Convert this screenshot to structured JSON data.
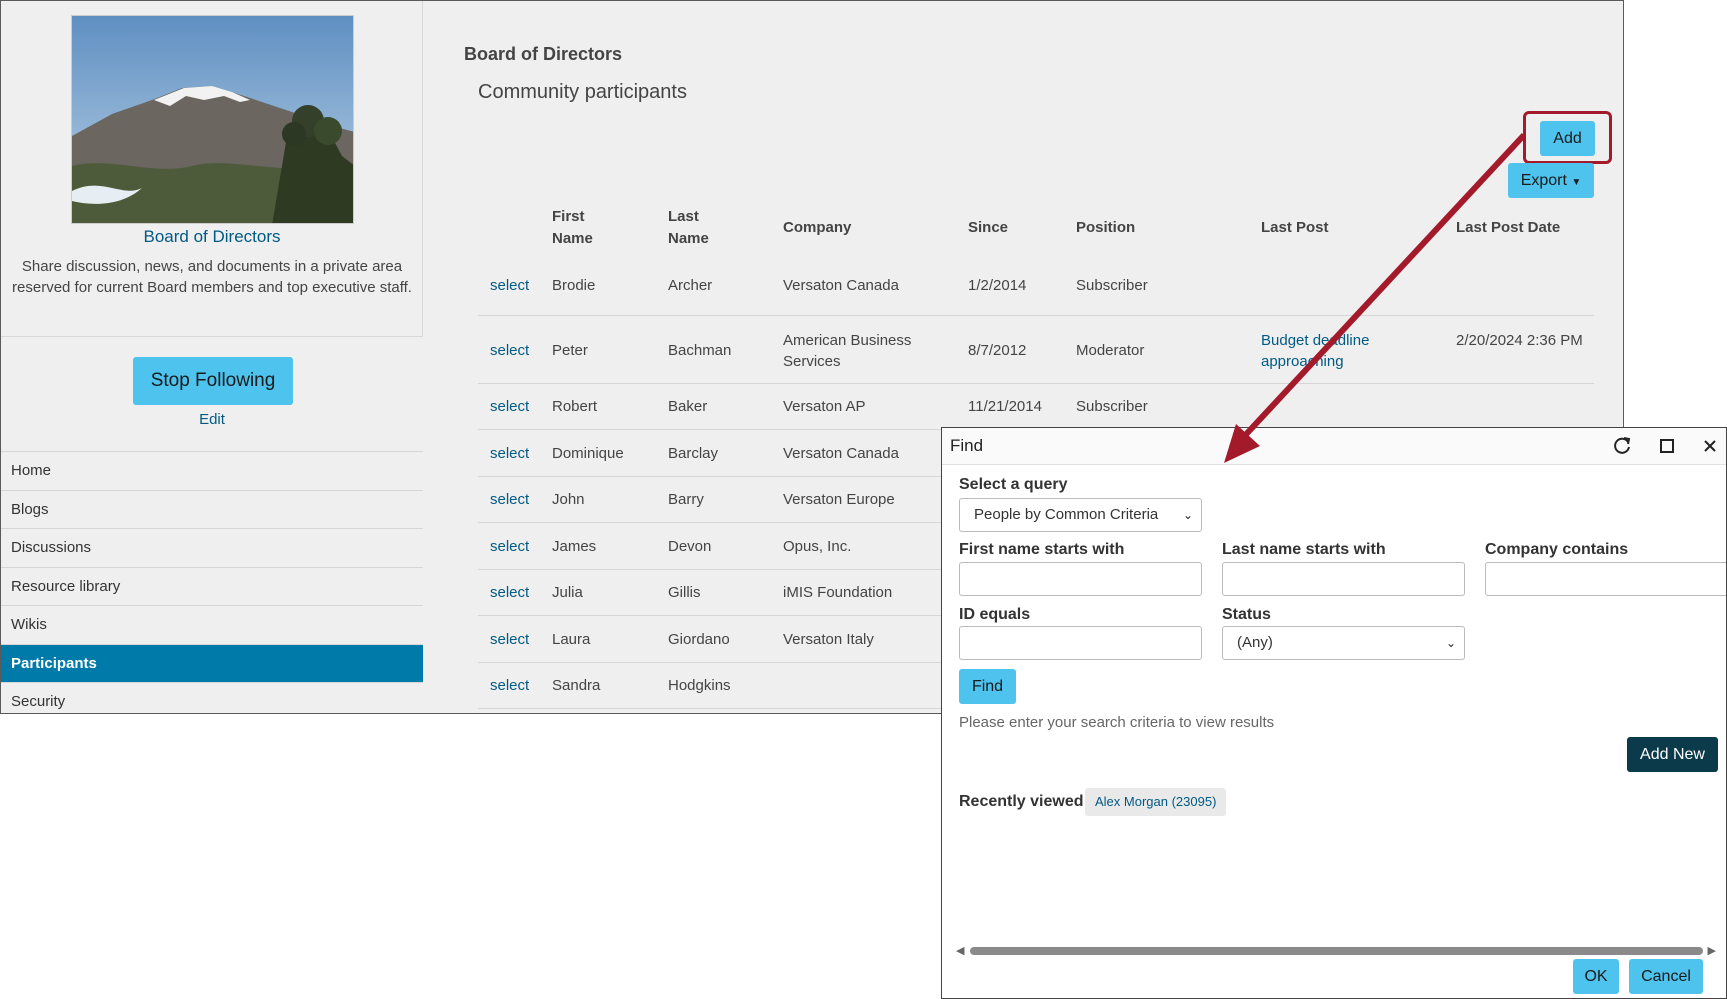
{
  "sidebar": {
    "group_title": "Board of Directors",
    "group_description": "Share discussion, news, and documents in a private area reserved for current Board members and top executive staff.",
    "stop_following_label": "Stop Following",
    "edit_label": "Edit",
    "nav": [
      "Home",
      "Blogs",
      "Discussions",
      "Resource library",
      "Wikis",
      "Participants",
      "Security"
    ],
    "active_nav": "Participants"
  },
  "main": {
    "heading": "Board of Directors",
    "subheading": "Community participants",
    "add_label": "Add",
    "export_label": "Export",
    "columns": {
      "first_name_1": "First",
      "first_name_2": "Name",
      "last_name_1": "Last",
      "last_name_2": "Name",
      "company": "Company",
      "since": "Since",
      "position": "Position",
      "last_post": "Last Post",
      "last_post_date": "Last Post Date"
    },
    "select_label": "select",
    "rows": [
      {
        "first": "Brodie",
        "last": "Archer",
        "company": "Versaton Canada",
        "since": "1/2/2014",
        "position": "Subscriber",
        "last_post": "",
        "last_post_date": ""
      },
      {
        "first": "Peter",
        "last": "Bachman",
        "company": "American Business Services",
        "since": "8/7/2012",
        "position": "Moderator",
        "last_post": "Budget deadline approaching",
        "last_post_date": "2/20/2024 2:36 PM"
      },
      {
        "first": "Robert",
        "last": "Baker",
        "company": "Versaton AP",
        "since": "11/21/2014",
        "position": "Subscriber",
        "last_post": "",
        "last_post_date": ""
      },
      {
        "first": "Dominique",
        "last": "Barclay",
        "company": "Versaton Canada",
        "since": "",
        "position": "",
        "last_post": "",
        "last_post_date": ""
      },
      {
        "first": "John",
        "last": "Barry",
        "company": "Versaton Europe",
        "since": "",
        "position": "",
        "last_post": "",
        "last_post_date": ""
      },
      {
        "first": "James",
        "last": "Devon",
        "company": "Opus, Inc.",
        "since": "",
        "position": "",
        "last_post": "",
        "last_post_date": ""
      },
      {
        "first": "Julia",
        "last": "Gillis",
        "company": "iMIS Foundation",
        "since": "",
        "position": "",
        "last_post": "",
        "last_post_date": ""
      },
      {
        "first": "Laura",
        "last": "Giordano",
        "company": "Versaton Italy",
        "since": "",
        "position": "",
        "last_post": "",
        "last_post_date": ""
      },
      {
        "first": "Sandra",
        "last": "Hodgkins",
        "company": "",
        "since": "",
        "position": "",
        "last_post": "",
        "last_post_date": ""
      }
    ]
  },
  "dialog": {
    "title": "Find",
    "select_query_label": "Select a query",
    "query_value": "People by Common Criteria",
    "first_name_label": "First name starts with",
    "last_name_label": "Last name starts with",
    "company_label": "Company contains",
    "id_label": "ID equals",
    "status_label": "Status",
    "status_value": "(Any)",
    "find_label": "Find",
    "hint": "Please enter your search criteria to view results",
    "add_new_label": "Add New",
    "recently_viewed_label": "Recently viewed",
    "recent_item": "Alex Morgan (23095)",
    "ok_label": "OK",
    "cancel_label": "Cancel"
  },
  "colors": {
    "accent": "#4dc3ee",
    "link": "#005a84",
    "nav_active": "#007aa8",
    "highlight": "#a31b2a",
    "add_new": "#0b3a4a"
  }
}
